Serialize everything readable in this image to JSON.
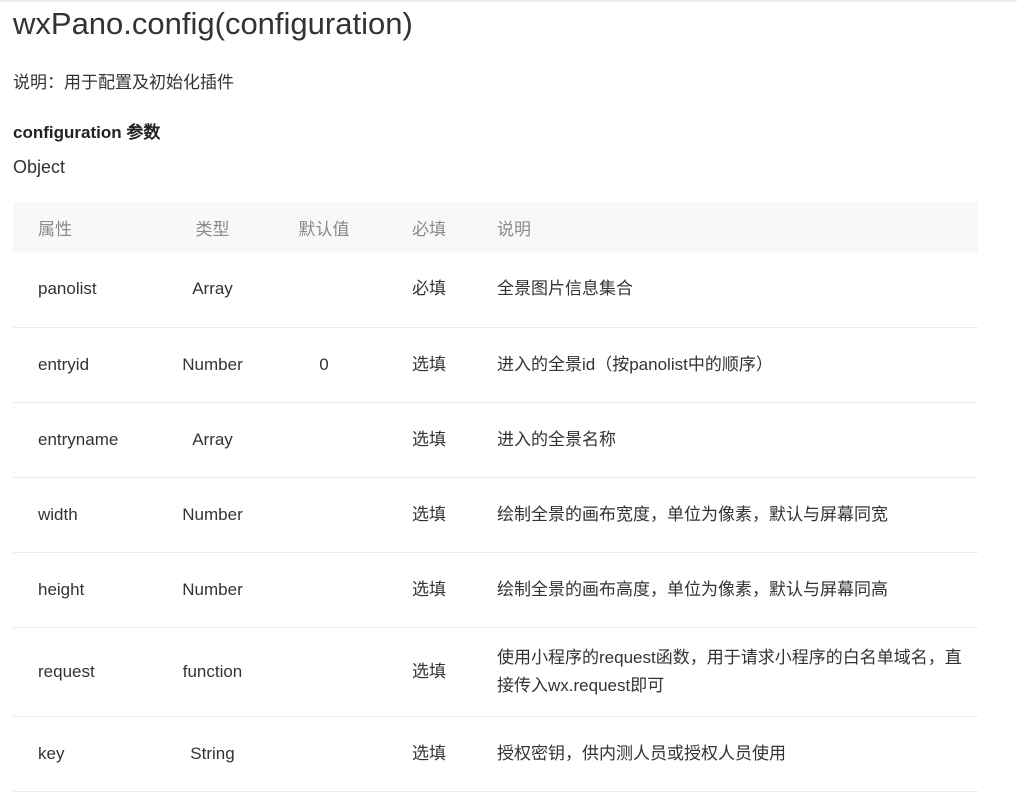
{
  "title": "wxPano.config(configuration)",
  "description": "说明：用于配置及初始化插件",
  "params_heading": "configuration 参数",
  "params_type": "Object",
  "table": {
    "headers": {
      "name": "属性",
      "type": "类型",
      "default": "默认值",
      "required": "必填",
      "description": "说明"
    },
    "rows": [
      {
        "name": "panolist",
        "type": "Array",
        "default": "",
        "required": "必填",
        "description": "全景图片信息集合"
      },
      {
        "name": "entryid",
        "type": "Number",
        "default": "0",
        "required": "选填",
        "description": "进入的全景id（按panolist中的顺序）"
      },
      {
        "name": "entryname",
        "type": "Array",
        "default": "",
        "required": "选填",
        "description": "进入的全景名称"
      },
      {
        "name": "width",
        "type": "Number",
        "default": "",
        "required": "选填",
        "description": "绘制全景的画布宽度，单位为像素，默认与屏幕同宽"
      },
      {
        "name": "height",
        "type": "Number",
        "default": "",
        "required": "选填",
        "description": "绘制全景的画布高度，单位为像素，默认与屏幕同高"
      },
      {
        "name": "request",
        "type": "function",
        "default": "",
        "required": "选填",
        "description": "使用小程序的request函数，用于请求小程序的白名单域名，直接传入wx.request即可"
      },
      {
        "name": "key",
        "type": "String",
        "default": "",
        "required": "选填",
        "description": "授权密钥，供内测人员或授权人员使用"
      }
    ]
  }
}
